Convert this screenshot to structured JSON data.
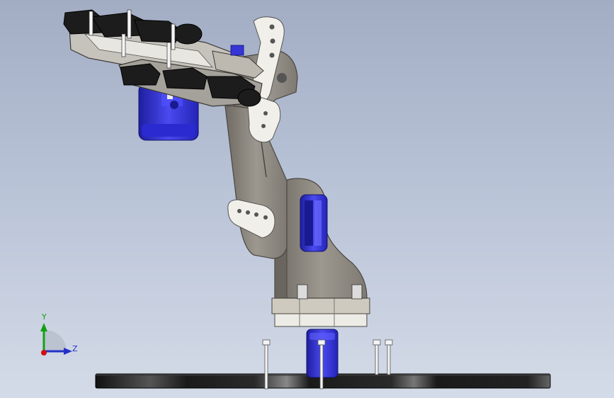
{
  "view": {
    "background_top": "#a2adc4",
    "background_bottom": "#d4dbe8"
  },
  "model": {
    "components": [
      "base-plate",
      "base-servo",
      "standoff-bolts",
      "shoulder-bracket",
      "shoulder-servo",
      "upper-arm",
      "elbow-servo-horn",
      "forearm-bracket",
      "wrist-servo",
      "gripper-assembly"
    ],
    "colors": {
      "bracket": "#8e8a82",
      "bracket_edge": "#4a4742",
      "servo_blue": "#3535d8",
      "servo_horn": "#f1efe9",
      "plate_black": "#1c1c1c",
      "bolt_white": "#f4f4f4"
    }
  },
  "triad": {
    "y_label": "Y",
    "z_label": "Z",
    "y_color": "#12a012",
    "z_color": "#2430c8",
    "x_color": "#d01010"
  }
}
